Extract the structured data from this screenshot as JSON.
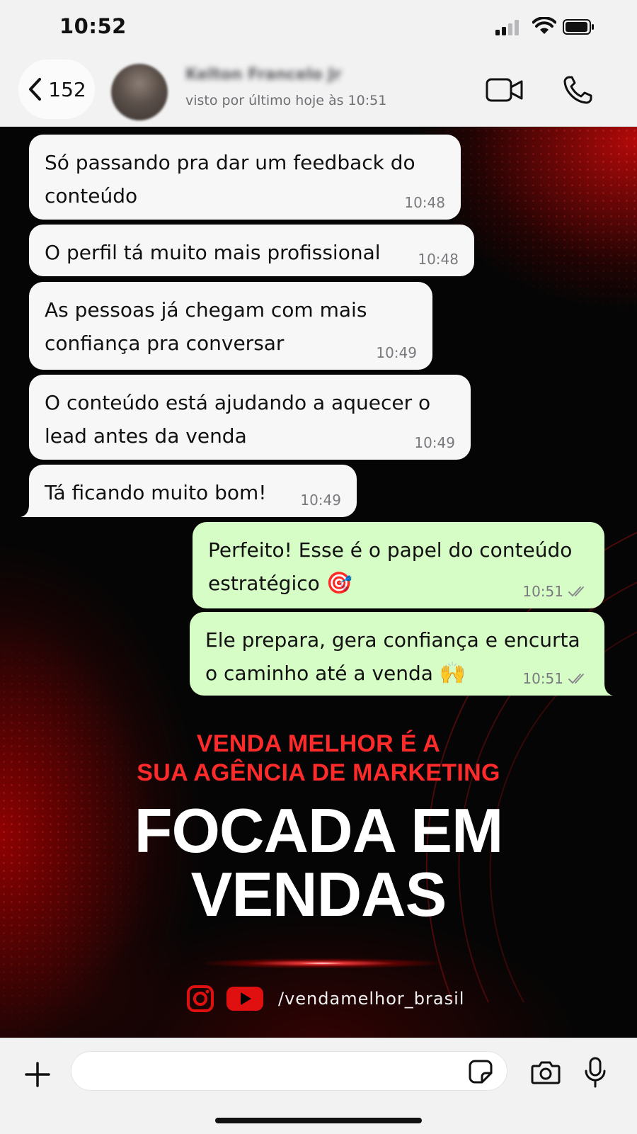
{
  "status_bar": {
    "time": "10:52"
  },
  "header": {
    "back_count": "152",
    "contact_name": "Kelton Francelo Jr",
    "last_seen": "visto por último hoje às 10:51"
  },
  "messages": [
    {
      "direction": "in",
      "text": "Só passando pra dar um feedback do conteúdo",
      "time": "10:48"
    },
    {
      "direction": "in",
      "text": "O perfil tá muito mais profissional",
      "time": "10:48"
    },
    {
      "direction": "in",
      "text": "As pessoas já chegam com mais confiança pra conversar",
      "time": "10:49"
    },
    {
      "direction": "in",
      "text": "O conteúdo está ajudando a aquecer o lead antes da venda",
      "time": "10:49"
    },
    {
      "direction": "in",
      "text": "Tá ficando muito bom!",
      "time": "10:49"
    },
    {
      "direction": "out",
      "text": "Perfeito! Esse é o papel do conteúdo estratégico",
      "emoji": "🎯",
      "time": "10:51"
    },
    {
      "direction": "out",
      "text": "Ele prepara, gera confiança e encurta o caminho até a venda",
      "emoji": "🙌",
      "time": "10:51"
    }
  ],
  "promo": {
    "line1": "VENDA MELHOR É A",
    "line2": "SUA AGÊNCIA DE MARKETING",
    "headline1": "FOCADA EM",
    "headline2": "VENDAS",
    "handle": "/vendamelhor_brasil"
  },
  "input_bar": {
    "placeholder": ""
  },
  "colors": {
    "incoming_bubble": "#f7f7f7",
    "outgoing_bubble": "#d6fdc6",
    "promo_red": "#ff2a2a",
    "background": "#050505"
  },
  "icons": [
    "back-chevron-icon",
    "video-call-icon",
    "phone-call-icon",
    "plus-icon",
    "sticker-icon",
    "camera-icon",
    "microphone-icon",
    "instagram-icon",
    "youtube-icon",
    "double-check-icon"
  ]
}
